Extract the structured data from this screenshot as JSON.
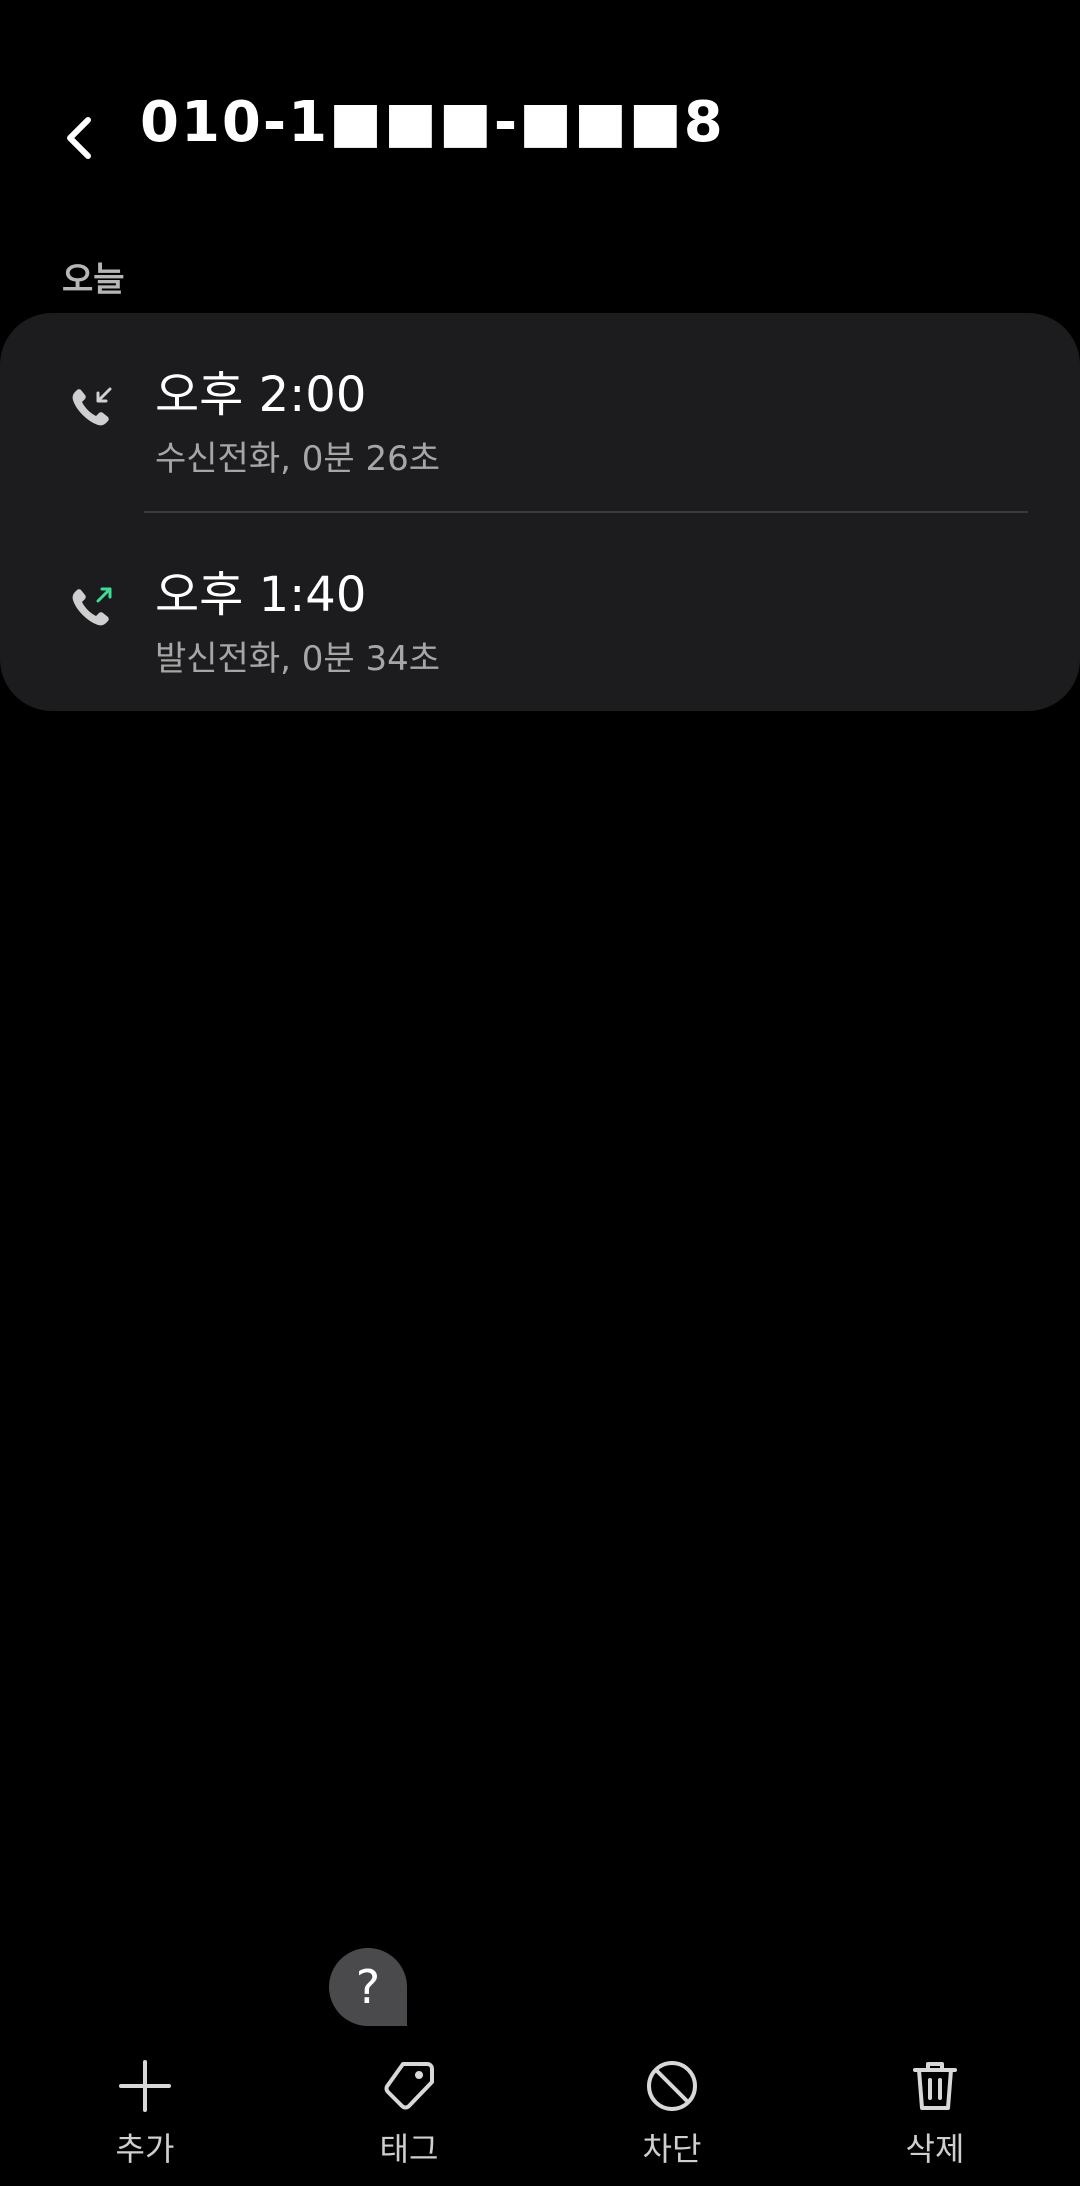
{
  "header": {
    "title": "010-1■■■-■■■8"
  },
  "section": {
    "label": "오늘"
  },
  "calls": [
    {
      "time": "오후 2:00",
      "detail": "수신전화, 0분 26초",
      "direction": "incoming",
      "icon": "incoming-call-icon",
      "icon_color": "#cfcfcf"
    },
    {
      "time": "오후 1:40",
      "detail": "발신전화, 0분 34초",
      "direction": "outgoing",
      "icon": "outgoing-call-icon",
      "icon_color": "#3ddc97"
    }
  ],
  "help": {
    "label": "?"
  },
  "toolbar": {
    "add_label": "추가",
    "tag_label": "태그",
    "block_label": "차단",
    "delete_label": "삭제"
  },
  "colors": {
    "background": "#000000",
    "card": "#1c1c1e",
    "accent_outgoing": "#3ddc97"
  }
}
